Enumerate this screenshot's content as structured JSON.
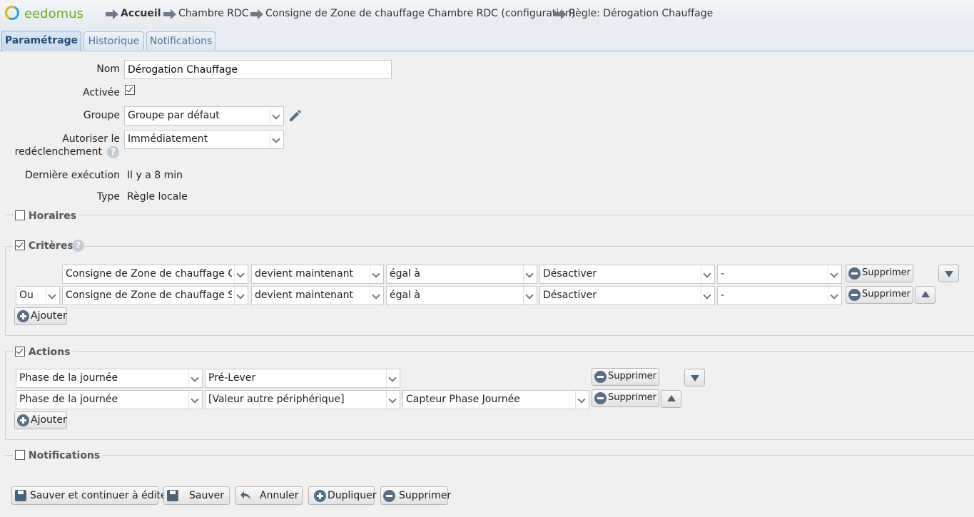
{
  "header": {
    "logo_text": "eedomus",
    "breadcrumb": [
      {
        "label": "Accueil"
      },
      {
        "label": "Chambre RDC"
      },
      {
        "label": "Consigne de Zone de chauffage Chambre RDC (configuration)"
      },
      {
        "label": "Règle: Dérogation Chauffage"
      }
    ]
  },
  "tabs": [
    {
      "label": "Paramétrage",
      "active": true
    },
    {
      "label": "Historique",
      "active": false
    },
    {
      "label": "Notifications",
      "active": false
    }
  ],
  "form": {
    "nom_label": "Nom",
    "nom_value": "Dérogation Chauffage",
    "activee_label": "Activée",
    "activee_checked": true,
    "groupe_label": "Groupe",
    "groupe_value": "Groupe par défaut",
    "redecl_label_1": "Autoriser le",
    "redecl_label_2": "redéclenchement",
    "redecl_value": "Immédiatement",
    "derniere_label": "Dernière exécution",
    "derniere_value": "Il y a 8 min",
    "type_label": "Type",
    "type_value": "Règle locale"
  },
  "sections": {
    "horaires": {
      "label": "Horaires",
      "checked": false
    },
    "criteres": {
      "label": "Critères",
      "checked": true
    },
    "actions": {
      "label": "Actions",
      "checked": true
    },
    "notifications": {
      "label": "Notifications",
      "checked": false
    }
  },
  "criteria": [
    {
      "connector": "",
      "device": "Consigne de Zone de chauffage Cha",
      "condition": "devient maintenant",
      "operator": "égal à",
      "value": "Désactiver",
      "extra": "-",
      "delete_label": "Supprimer"
    },
    {
      "connector": "Ou",
      "device": "Consigne de Zone de chauffage Séj",
      "condition": "devient maintenant",
      "operator": "égal à",
      "value": "Désactiver",
      "extra": "-",
      "delete_label": "Supprimer"
    }
  ],
  "actions": [
    {
      "device": "Phase de la journée",
      "value": "Pré-Lever",
      "source": "",
      "delete_label": "Supprimer"
    },
    {
      "device": "Phase de la journée",
      "value": "[Valeur autre périphérique]",
      "source": "Capteur Phase Journée",
      "delete_label": "Supprimer"
    }
  ],
  "add_label": "Ajouter",
  "footer": {
    "save_continue": "Sauver et continuer à éditer",
    "save": "Sauver",
    "cancel": "Annuler",
    "duplicate": "Dupliquer",
    "delete": "Supprimer"
  },
  "colors": {
    "accent": "#4a6f96",
    "logo_green": "#6fa82c",
    "logo_blue": "#2aa5d9",
    "logo_yellow": "#f2b21b",
    "icon": "#5a6d82"
  }
}
